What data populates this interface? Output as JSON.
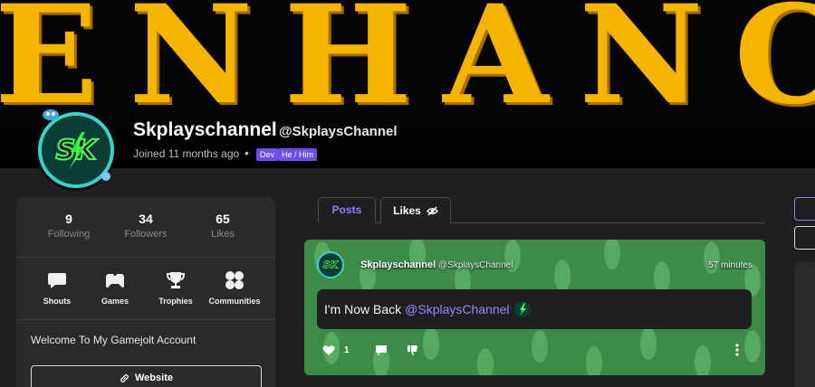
{
  "banner": {
    "text": "ENHANCE"
  },
  "profile": {
    "display_name": "Skplayschannel",
    "handle": "@SkplaysChannel",
    "joined": "Joined 11 months ago",
    "dot": "•",
    "tags": [
      "Dev",
      "He / Him"
    ],
    "avatar_letters": "SK"
  },
  "stats": [
    {
      "value": "9",
      "label": "Following"
    },
    {
      "value": "34",
      "label": "Followers"
    },
    {
      "value": "65",
      "label": "Likes"
    }
  ],
  "nav": [
    {
      "label": "Shouts",
      "icon": "shouts-icon"
    },
    {
      "label": "Games",
      "icon": "gamepad-icon"
    },
    {
      "label": "Trophies",
      "icon": "trophy-icon"
    },
    {
      "label": "Communities",
      "icon": "communities-icon"
    }
  ],
  "bio": "Welcome To My Gamejolt Account",
  "website_label": "Website",
  "tabs": [
    {
      "label": "Posts",
      "active": true
    },
    {
      "label": "Likes",
      "icon": "eye-off-icon"
    }
  ],
  "post": {
    "author": "Skplayschannel",
    "handle": "@SkplaysChannel",
    "time": "57 minutes",
    "text": "I'm Now Back",
    "mention": "@SkplaysChannel",
    "like_count": "1"
  },
  "colors": {
    "accent": "#8f7bff",
    "banner": "#f4b400",
    "avatar_ring": "#36d3c8",
    "tag": "#6e4ee6"
  }
}
